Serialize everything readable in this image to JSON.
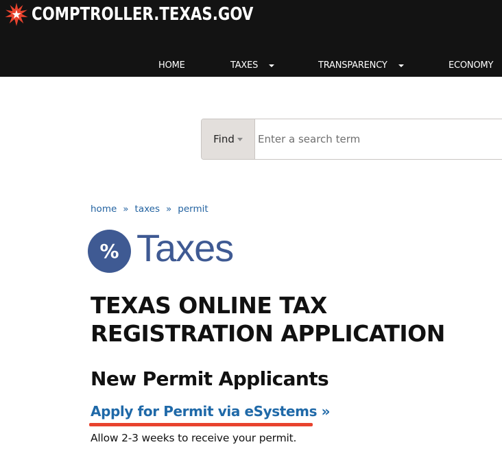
{
  "header": {
    "logo_text": "COMPTROLLER.TEXAS.GOV",
    "logo_icon": "starburst-icon",
    "colors": {
      "background": "#131313",
      "logo_star": "#e8432e"
    }
  },
  "nav": {
    "items": [
      {
        "label": "HOME",
        "has_dropdown": false
      },
      {
        "label": "TAXES",
        "has_dropdown": true
      },
      {
        "label": "TRANSPARENCY",
        "has_dropdown": true
      },
      {
        "label": "ECONOMY",
        "has_dropdown": false
      }
    ]
  },
  "search": {
    "find_label": "Find",
    "placeholder": "Enter a search term",
    "value": ""
  },
  "breadcrumb": {
    "items": [
      "home",
      "taxes",
      "permit"
    ],
    "separator": "»"
  },
  "section": {
    "icon_symbol": "%",
    "label": "Taxes",
    "color": "#3f5a93"
  },
  "content": {
    "page_title": "TEXAS ONLINE TAX REGISTRATION APPLICATION",
    "subheading": "New Permit Applicants",
    "apply_link": "Apply for Permit via eSystems »",
    "allow_text": "Allow 2-3 weeks to receive your permit.",
    "link_color": "#1f69a8",
    "annotation_color": "#e8432e"
  }
}
